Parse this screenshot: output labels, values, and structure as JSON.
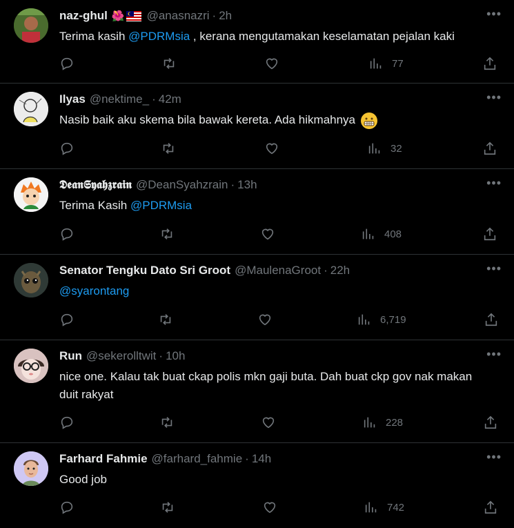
{
  "tweets": [
    {
      "name": "naz-ghul",
      "name_emoji": "🌺",
      "handle": "@anasnazri",
      "time": "2h",
      "text_parts": [
        "Terima kasih ",
        "@PDRMsia",
        " , kerana mengutamakan keselamatan pejalan kaki"
      ],
      "views": "77",
      "avatar_color": "#6b8f3e"
    },
    {
      "name": "Ilyas",
      "handle": "@nektime_",
      "time": "42m",
      "text_parts": [
        "Nasib baik aku skema bila bawak kereta. Ada hikmahnya"
      ],
      "views": "32",
      "avatar_color": "#d8d8d8"
    },
    {
      "name": "𝕯𝖊𝖆𝖓𝕾𝖞𝖆𝖍𝖟𝖗𝖆𝖎𝖓",
      "handle": "@DeanSyahzrain",
      "time": "13h",
      "text_parts": [
        "Terima Kasih ",
        "@PDRMsia"
      ],
      "views": "408",
      "avatar_color": "#f0f0f0"
    },
    {
      "name": "Senator Tengku Dato Sri Groot",
      "handle": "@MaulenaGroot",
      "time": "22h",
      "text_parts": [
        "@syarontang"
      ],
      "views": "6,719",
      "avatar_color": "#4a4a44"
    },
    {
      "name": "Run",
      "handle": "@sekerolltwit",
      "time": "10h",
      "text_parts": [
        "nice one. Kalau tak buat ckap polis mkn gaji buta. Dah buat ckp gov nak makan duit rakyat"
      ],
      "views": "228",
      "avatar_color": "#e8d0cc"
    },
    {
      "name": "Farhard Fahmie",
      "handle": "@farhard_fahmie",
      "time": "14h",
      "text_parts": [
        "Good job"
      ],
      "views": "742",
      "avatar_color": "#c9c4f2"
    }
  ],
  "more_label": "•••",
  "separator": "·"
}
